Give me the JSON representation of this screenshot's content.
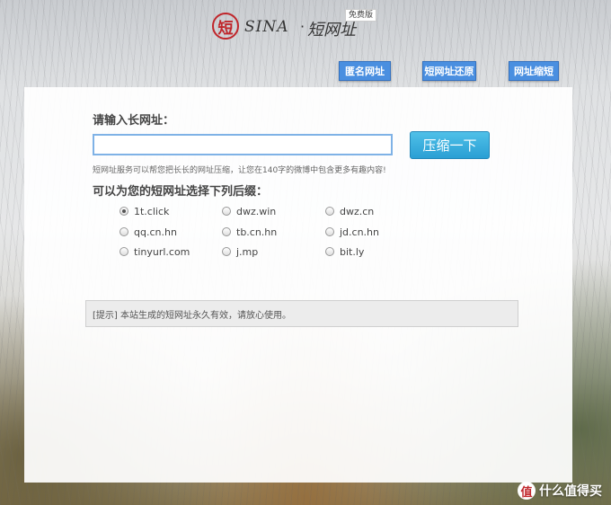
{
  "header": {
    "logo_char": "短",
    "logo_sina": "SINA",
    "logo_dot": "·",
    "logo_name": "短网址",
    "free_tag": "免费版"
  },
  "nav": {
    "anon_url": "匿名网址",
    "restore_url": "短网址还原",
    "shorten_url": "网址缩短"
  },
  "form": {
    "prompt_label": "请输入长网址：",
    "url_value": "",
    "compress_label": "压缩一下",
    "hint": "短网址服务可以帮您把长长的网址压缩，让您在140字的微博中包含更多有趣内容!",
    "suffix_label": "可以为您的短网址选择下列后缀：",
    "suffixes": [
      "1t.click",
      "dwz.win",
      "dwz.cn",
      "qq.cn.hn",
      "tb.cn.hn",
      "jd.cn.hn",
      "tinyurl.com",
      "j.mp",
      "bit.ly"
    ],
    "selected_suffix": "1t.click"
  },
  "notice": "[提示] 本站生成的短网址永久有效，请放心使用。",
  "watermark": {
    "badge": "值",
    "text": "什么值得买"
  }
}
